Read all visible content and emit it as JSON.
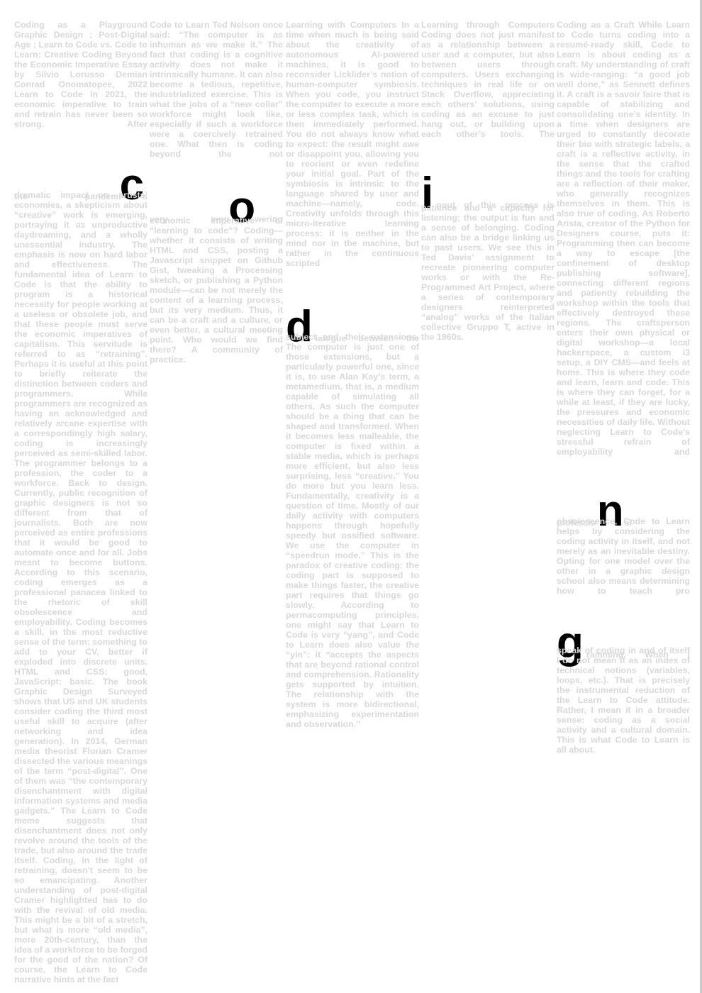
{
  "page": {
    "colors": {
      "text": "#d9d9d9",
      "accent": "#000000",
      "background": "#ffffff"
    }
  },
  "big_letters": [
    "c",
    "o",
    "d",
    "i",
    "n",
    "g"
  ],
  "col1": {
    "a": "Coding as a Playground Graphic Design ; Post-Digital Age ; Learn to Code vs. Code to Learn: Creative Coding Beyond the Economic Imperative Essay by Silvio Lorusso Demian Conrad Onomatopee, 2022 Learn to Code In 2021, the economic imperative to train and retrain has never been so strong. After",
    "b1": "the",
    "b2": "pandemi",
    "b3": "s",
    "c": "dramatic impact on artists’ economies, a skepticism about “creative” work is emerging, portraying it as unproductive daydreaming, and a wholly unessential industry. The emphasis is now on hard labor and effectiveness. The fundamental idea of Learn to Code is that the ability to program is a historical necessity for people working at a useless or obsolete job, and that these people must serve the economic imperatives of capitalism. This servitude is referred to as “retraining”. Perhaps it is useful at this point to briefly reiterate the distinction between coders and programmers. While programmers are recognized as having an acknowledged and relatively arcane expertise with a correspondingly high salary, coding is increasingly perceived as semi-skilled labor. The programmer belongs to a profession, the coder to a workforce. Back to design. Currently, public recognition of graphic designers is not so different from that of journalists. Both are now perceived as entire professions that it would be good to automate once and for all. Jobs meant to become buttons. According to this scenario, coding emerges as a professional panacea linked to the rhetoric of skill obsolescence and employability. Coding becomes a skill, in the most reductive sense of the term: something to add to your CV, better if exploded into discrete units. HTML and CSS: good, JavaScript: basic. The book Graphic Design Surveyed shows that US and UK students consider coding the third most useful skill to acquire (after networking and idea generation). In 2014, German media theorist Florian Cramer dissected the various meanings of the term “post-digital”. One of them was “the contemporary disenchantment with digital information systems and media gadgets.” The Learn to Code meme suggests that disenchantment does not only revolve around the tools of the trade, but also around the trade itself. Coding, in the light of retraining, doesn’t seem to be so emancipating. Another understanding of post-digital Cramer highlighted has to do with the revival of old media. This might be a bit of a stretch, but what is more “old media”, more 20th-century, than the idea of a workforce to be forged for the good of the nation? Of course, the Learn to Code narrative hints at the fact"
  },
  "col2": {
    "a": "Code to Learn Ted Nelson once said: “The computer is as inhuman as we make it.” The fact that coding is a cognitive activity does not make it intrinsically humane. It can also become a tedious, repetitive, industrialized exercise. This is what the jobs of a “new collar” workforce might look like, especially if such a workforce were a coercively retrained one. What then is coding beyond the not",
    "b1": "very",
    "b2": "emp",
    "b3": "wering",
    "c": "economic imperative of “learning to code”? Coding—whether it consists of writing HTML and CSS, posting a Javascript snippet on Github Gist, tweaking a Processing sketch, or publishing a Python module—can be not merely the content of a learning process, but its very medium. Thus, it can be a craft and a culture, or even better, a cultural meeting point. Who would we find there? A community of practice."
  },
  "col3": {
    "a": "Learning with Computers In a time when much is being said about the creativity of autonomous AI-powered machines, it is good to reconsider Licklider’s notion of human-computer symbiosis. When you code, you instruct the computer to execute a more or less complex task, which is then immediately performed. You do not always know what to expect: the result might awe or disappoint you, allowing you to reorient or even redefine your initial goal. Part of the symbiosis is intrinsic to the language shared by user and machine—namely, code. Creativity unfolds through this micro-iterative learning process: it is neither in the mind nor in the machine, but rather in the continuous scripted",
    "b3": "ialogue between the",
    "c": "subject and their extensions. The computer is just one of those extensions, but a particularly powerful one, since it is, to use Alan Kay’s term, a metamedium, that is, a medium capable of simulating all others. As such the computer should be a thing that can be shaped and transformed. When it becomes less malleable, the computer is fixed within a stable media, which is perhaps more efficient, but also less surprising, less “creative.” You do more but you learn less. Fundamentally, creativity is a question of time. Mostly of our daily activity with computers happens through hopefully speedy but ossified software. We use the computer in “speedrun mode.” This is the paradox of creative coding: the coding part is supposed to make things faster, the creative part requires that things go slowly. According to permacomputing principles, one might say that Learn to Code is very “yang”, and Code to Learn does also value the “yin”: it “accepts the aspects that are beyond rational control and comprehension. Rationality gets supported by intuition. The relationship with the system is more bidirectional, emphasizing experimentation and observation.”"
  },
  "col4": {
    "a": "Learning through Computers Coding does not just manifest as a relationship between a user and a computer, but also between users through computers. Users exchanging techniques in real life or on Stack Overflow, appreciating each others’ solutions, using coding as an excuse to just hang out, or building upon each other’s tools. The",
    "b3": "nput of this process is",
    "c": "patience and a capacity for listening; the output is fun and a sense of belonging. Coding can also be a bridge linking us to past users. We see this in Ted Davis’ assignment to recreate pioneering computer works or with the Re-Programmed Art Project, where a series of contemporary designers reinterpreted “analog” works of the Italian collective Gruppo T, active in the 1960s."
  },
  "col5": {
    "a": "Coding as a Craft While Learn to Code turns coding into a resumé-ready skill, Code to Learn is about coding as a craft. My understanding of craft is wide-ranging: “a good job well done,” as Sennett defines it. A craft is a savoir faire that is capable of stabilizing and consolidating one’s identity. In a time when designers are urged to constantly decorate their bio with strategic labels, a craft is a reflective activity, in the sense that the crafted things and the tools for crafting are a reflection of their maker, who generally recognizes themselves in them. This is also true of coding. As Roberto Arista, creator of the Python for Designers course, puts it: Programming then can become a way to escape [the confinement of desktop publishing software], connecting different regions and patiently rebuilding the workshop within the tools that effectively destroyed these regions. The craftsperson enters their own physical or digital workshop—a local hackerspace, a custom i3 setup, a DIY CMS—and feels at home. This is where they code and learn, learn and code. This is where they can forget, for a while at least, if they are lucky, the pressures and economic necessities of daily life. Without neglecting Learn to Code’s stressful refrain of employability and",
    "b1": "professio",
    "b3": "al",
    "c": "obsolescence, Code to Learn helps by considering the coding activity in itself, and not merely as an inevitable destiny. Opting for one model over the other in a graphic design school also means determining how to teach pro",
    "d3": "ramming. When I",
    "e": "speak of coding in and of itself I do not mean it as an index of technical notions (variables, loops, etc.). That is precisely the instrumental reduction of the Learn to Code attitude. Rather, I mean it in a broader sense: coding as a social activity and a cultural domain. This is what Code to Learn is all about."
  }
}
